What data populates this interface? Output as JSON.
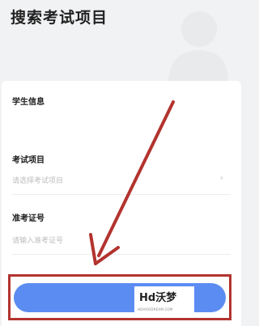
{
  "page": {
    "title": "搜索考试项目"
  },
  "form": {
    "student_info_label": "学生信息",
    "exam_item_label": "考试项目",
    "exam_item_placeholder": "请选择考试项目",
    "exam_item_chevron": "›",
    "admission_label": "准考证号",
    "admission_placeholder": "请输入准考证号"
  },
  "submit": {
    "label": ""
  },
  "watermark": {
    "text": "Hd沃梦",
    "subtext": "HDHOODREAM.COM"
  },
  "colors": {
    "accent": "#5b8cf2",
    "annotation": "#b3332e"
  },
  "icons": {
    "silhouette": "person-silhouette-icon",
    "arrow": "annotation-arrow-icon"
  }
}
